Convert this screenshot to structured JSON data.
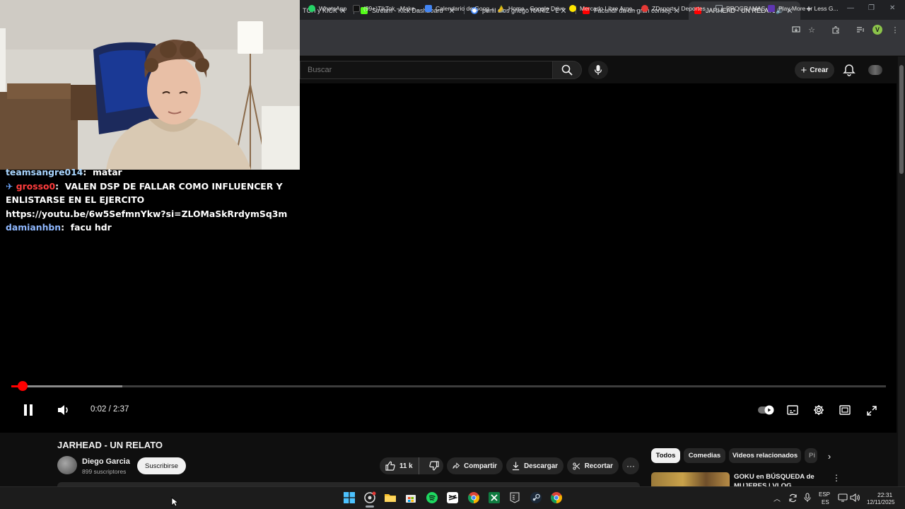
{
  "browser": {
    "tabs": [
      {
        "title": "TCH y KICK Al",
        "icon_color": "#9146ff"
      },
      {
        "title": "Stream - Kick Dashboard",
        "icon_color": "#53fc18"
      },
      {
        "title": "perfil dios griego NARIZ - Busc",
        "icon_color": "#4285f4"
      },
      {
        "title": "Facuhdr da un gran consejo de",
        "icon_color": "#ff0000"
      },
      {
        "title": "JARHEAD - UN RELATO - Yo",
        "icon_color": "#ff0000",
        "active": true
      }
    ],
    "new_tab": "+",
    "window_controls": [
      "—",
      "❐",
      "✕"
    ],
    "profile_initial": "V",
    "bookmarks": [
      {
        "label": "WhatsApp",
        "icon_color": "#25d366"
      },
      {
        "label": "(99+)TikTok - Make...",
        "icon_color": "#111111"
      },
      {
        "label": "Calendario de Goog...",
        "icon_color": "#4285f4"
      },
      {
        "label": "Home - Google Drive",
        "icon_color": "#fbbc04"
      },
      {
        "label": "Mercado Libre Arge...",
        "icon_color": "#ffe600"
      },
      {
        "label": "ZDsports | Deportes...",
        "icon_color": "#e53935"
      },
      {
        "label": "PROGRAMAS",
        "icon_color": "#9aa0a6"
      },
      {
        "label": "Play More or Less G...",
        "icon_color": "#5e35b1"
      }
    ]
  },
  "youtube": {
    "search_placeholder": "Buscar",
    "create_label": "Crear"
  },
  "stream_overlay": {
    "chat": [
      {
        "user": "teamsangre014",
        "message": "matar"
      },
      {
        "badge": "✈",
        "user": "grosso0",
        "message": "VALEN DSP DE FALLAR COMO INFLUENCER Y ENLISTARSE EN EL EJERCITO https://youtu.be/6w5SefmnYkw?si=ZLOMaSkRrdymSq3m"
      },
      {
        "user": "damianhbn",
        "message": "facu hdr"
      }
    ]
  },
  "player": {
    "time_current": "0:02",
    "time_total": "2:37",
    "played_fraction": 0.013,
    "buffered_fraction": 0.127
  },
  "video": {
    "title": "JARHEAD - UN RELATO",
    "channel": "Diego Garcia",
    "subscribers": "899 suscriptores",
    "subscribe_label": "Suscribirse",
    "likes": "11 k",
    "share_label": "Compartir",
    "download_label": "Descargar",
    "clip_label": "Recortar",
    "more_label": "···"
  },
  "sidebar": {
    "chips": [
      "Todos",
      "Comedias",
      "Videos relacionados",
      "Pi"
    ],
    "recommended": [
      {
        "title": "GOKU en BÚSQUEDA de MUJERES | VLOG"
      }
    ]
  },
  "taskbar": {
    "language": "ESP",
    "region": "ES",
    "time": "22:31",
    "date": "12/11/2025"
  }
}
